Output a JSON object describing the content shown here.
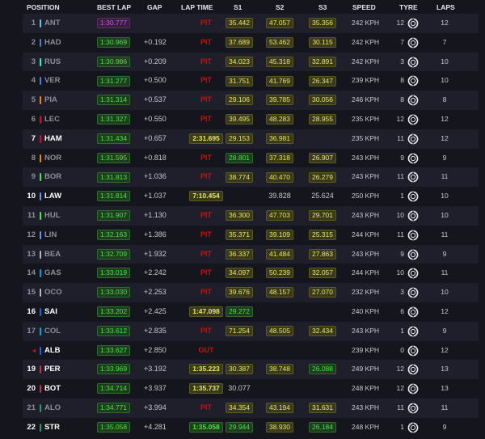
{
  "columns": [
    "POSITION",
    "BEST LAP",
    "GAP",
    "LAP TIME",
    "S1",
    "S2",
    "S3",
    "SPEED",
    "TYRE",
    "LAPS"
  ],
  "rows": [
    {
      "pos": "1",
      "code": "ANT",
      "team": "#64c4ff",
      "best": "1:30.777",
      "best_color": "purple",
      "gap": "",
      "lap": "PIT",
      "lap_type": "pit",
      "s1": "35.442",
      "s1c": "yellow",
      "s2": "47.057",
      "s2c": "yellow",
      "s3": "35.356",
      "s3c": "yellow",
      "speed": "242 KPH",
      "tyre_age": "12",
      "tyre_icon": "hard-tyre-icon",
      "laps": "12",
      "hl": false
    },
    {
      "pos": "2",
      "code": "HAD",
      "team": "#4781d7",
      "best": "1:30.969",
      "best_color": "green",
      "gap": "+0.192",
      "lap": "PIT",
      "lap_type": "pit",
      "s1": "37.689",
      "s1c": "yellow",
      "s2": "53.462",
      "s2c": "yellow",
      "s3": "30.115",
      "s3c": "yellow",
      "speed": "242 KPH",
      "tyre_age": "7",
      "tyre_icon": "medium-tyre-icon",
      "laps": "7",
      "hl": false
    },
    {
      "pos": "3",
      "code": "RUS",
      "team": "#27f4d2",
      "best": "1:30.986",
      "best_color": "green",
      "gap": "+0.209",
      "lap": "PIT",
      "lap_type": "pit",
      "s1": "34.023",
      "s1c": "yellow",
      "s2": "45.318",
      "s2c": "yellow",
      "s3": "32.891",
      "s3c": "yellow",
      "speed": "242 KPH",
      "tyre_age": "3",
      "tyre_icon": "medium-tyre-icon",
      "laps": "10",
      "hl": false
    },
    {
      "pos": "4",
      "code": "VER",
      "team": "#4781d7",
      "best": "1:31.277",
      "best_color": "green",
      "gap": "+0.500",
      "lap": "PIT",
      "lap_type": "pit",
      "s1": "31.751",
      "s1c": "yellow",
      "s2": "41.769",
      "s2c": "yellow",
      "s3": "26.347",
      "s3c": "yellow",
      "speed": "239 KPH",
      "tyre_age": "8",
      "tyre_icon": "medium-tyre-icon",
      "laps": "10",
      "hl": false
    },
    {
      "pos": "5",
      "code": "PIA",
      "team": "#ff8000",
      "best": "1:31.314",
      "best_color": "green",
      "gap": "+0.537",
      "lap": "PIT",
      "lap_type": "pit",
      "s1": "29.106",
      "s1c": "yellow",
      "s2": "39.785",
      "s2c": "yellow",
      "s3": "30.056",
      "s3c": "yellow",
      "speed": "246 KPH",
      "tyre_age": "8",
      "tyre_icon": "medium-tyre-icon",
      "laps": "8",
      "hl": false
    },
    {
      "pos": "6",
      "code": "LEC",
      "team": "#e8002d",
      "best": "1:31.327",
      "best_color": "green",
      "gap": "+0.550",
      "lap": "PIT",
      "lap_type": "pit",
      "s1": "39.495",
      "s1c": "yellow",
      "s2": "48.283",
      "s2c": "yellow",
      "s3": "28.955",
      "s3c": "yellow",
      "speed": "235 KPH",
      "tyre_age": "12",
      "tyre_icon": "hard-tyre-icon",
      "laps": "12",
      "hl": false
    },
    {
      "pos": "7",
      "code": "HAM",
      "team": "#e8002d",
      "best": "1:31.434",
      "best_color": "green",
      "gap": "+0.657",
      "lap": "2:31.695",
      "lap_type": "time",
      "s1": "29.153",
      "s1c": "yellow",
      "s2": "36.981",
      "s2c": "yellow",
      "s3": "",
      "s3c": "none",
      "speed": "235 KPH",
      "tyre_age": "11",
      "tyre_icon": "hard-tyre-icon",
      "laps": "12",
      "hl": true
    },
    {
      "pos": "8",
      "code": "NOR",
      "team": "#ff8000",
      "best": "1:31.595",
      "best_color": "green",
      "gap": "+0.818",
      "lap": "PIT",
      "lap_type": "pit",
      "s1": "28.801",
      "s1c": "green",
      "s2": "37.318",
      "s2c": "yellow",
      "s3": "26.907",
      "s3c": "yellow",
      "speed": "243 KPH",
      "tyre_age": "9",
      "tyre_icon": "medium-tyre-icon",
      "laps": "9",
      "hl": false
    },
    {
      "pos": "9",
      "code": "BOR",
      "team": "#52e252",
      "best": "1:31.813",
      "best_color": "green",
      "gap": "+1.036",
      "lap": "PIT",
      "lap_type": "pit",
      "s1": "38.774",
      "s1c": "yellow",
      "s2": "40.470",
      "s2c": "yellow",
      "s3": "26.279",
      "s3c": "yellow",
      "speed": "243 KPH",
      "tyre_age": "11",
      "tyre_icon": "medium-tyre-icon",
      "laps": "11",
      "hl": false
    },
    {
      "pos": "10",
      "code": "LAW",
      "team": "#6692ff",
      "best": "1:31.814",
      "best_color": "green",
      "gap": "+1.037",
      "lap": "7:10.454",
      "lap_type": "time",
      "s1": "",
      "s1c": "none",
      "s2": "39.828",
      "s2c": "none",
      "s3": "25.624",
      "s3c": "none",
      "speed": "250 KPH",
      "tyre_age": "1",
      "tyre_icon": "medium-tyre-icon",
      "laps": "10",
      "hl": true
    },
    {
      "pos": "11",
      "code": "HUL",
      "team": "#52e252",
      "best": "1:31.907",
      "best_color": "green",
      "gap": "+1.130",
      "lap": "PIT",
      "lap_type": "pit",
      "s1": "36.300",
      "s1c": "yellow",
      "s2": "47.703",
      "s2c": "yellow",
      "s3": "29.701",
      "s3c": "yellow",
      "speed": "243 KPH",
      "tyre_age": "10",
      "tyre_icon": "medium-tyre-icon",
      "laps": "10",
      "hl": false
    },
    {
      "pos": "12",
      "code": "LIN",
      "team": "#6692ff",
      "best": "1:32.163",
      "best_color": "green",
      "gap": "+1.386",
      "lap": "PIT",
      "lap_type": "pit",
      "s1": "35.371",
      "s1c": "yellow",
      "s2": "39.109",
      "s2c": "yellow",
      "s3": "25.315",
      "s3c": "yellow",
      "speed": "244 KPH",
      "tyre_age": "11",
      "tyre_icon": "medium-tyre-icon",
      "laps": "11",
      "hl": false
    },
    {
      "pos": "13",
      "code": "BEA",
      "team": "#b6babd",
      "best": "1:32.709",
      "best_color": "green",
      "gap": "+1.932",
      "lap": "PIT",
      "lap_type": "pit",
      "s1": "36.337",
      "s1c": "yellow",
      "s2": "41.484",
      "s2c": "yellow",
      "s3": "27.863",
      "s3c": "yellow",
      "speed": "243 KPH",
      "tyre_age": "9",
      "tyre_icon": "medium-tyre-icon",
      "laps": "9",
      "hl": false
    },
    {
      "pos": "14",
      "code": "GAS",
      "team": "#00a1e8",
      "best": "1:33.019",
      "best_color": "green",
      "gap": "+2.242",
      "lap": "PIT",
      "lap_type": "pit",
      "s1": "34.097",
      "s1c": "yellow",
      "s2": "50.239",
      "s2c": "yellow",
      "s3": "32.057",
      "s3c": "yellow",
      "speed": "244 KPH",
      "tyre_age": "10",
      "tyre_icon": "medium-tyre-icon",
      "laps": "11",
      "hl": false
    },
    {
      "pos": "15",
      "code": "OCO",
      "team": "#b6babd",
      "best": "1:33.030",
      "best_color": "green",
      "gap": "+2.253",
      "lap": "PIT",
      "lap_type": "pit",
      "s1": "39.676",
      "s1c": "yellow",
      "s2": "48.157",
      "s2c": "yellow",
      "s3": "27.070",
      "s3c": "yellow",
      "speed": "232 KPH",
      "tyre_age": "3",
      "tyre_icon": "medium-tyre-icon",
      "laps": "10",
      "hl": false
    },
    {
      "pos": "16",
      "code": "SAI",
      "team": "#1868db",
      "best": "1:33.202",
      "best_color": "green",
      "gap": "+2.425",
      "lap": "1:47.098",
      "lap_type": "time",
      "s1": "29.272",
      "s1c": "green",
      "s2": "",
      "s2c": "none",
      "s3": "",
      "s3c": "none",
      "speed": "240 KPH",
      "tyre_age": "6",
      "tyre_icon": "medium-tyre-icon",
      "laps": "12",
      "hl": true
    },
    {
      "pos": "17",
      "code": "COL",
      "team": "#00a1e8",
      "best": "1:33.612",
      "best_color": "green",
      "gap": "+2.835",
      "lap": "PIT",
      "lap_type": "pit",
      "s1": "71.254",
      "s1c": "yellow",
      "s2": "48.505",
      "s2c": "yellow",
      "s3": "32.434",
      "s3c": "yellow",
      "speed": "243 KPH",
      "tyre_age": "1",
      "tyre_icon": "medium-tyre-icon",
      "laps": "9",
      "hl": false
    },
    {
      "pos": "◂",
      "code": "ALB",
      "team": "#1868db",
      "best": "1:33.627",
      "best_color": "green",
      "gap": "+2.850",
      "lap": "OUT",
      "lap_type": "out",
      "s1": "",
      "s1c": "none",
      "s2": "",
      "s2c": "none",
      "s3": "",
      "s3c": "none",
      "speed": "239 KPH",
      "tyre_age": "0",
      "tyre_icon": "medium-tyre-icon",
      "laps": "12",
      "hl": true
    },
    {
      "pos": "19",
      "code": "PER",
      "team": "#c92d4b",
      "best": "1:33.969",
      "best_color": "green",
      "gap": "+3.192",
      "lap": "1:35.223",
      "lap_type": "time",
      "s1": "30.387",
      "s1c": "yellow",
      "s2": "38.748",
      "s2c": "yellow",
      "s3": "26.088",
      "s3c": "green",
      "speed": "249 KPH",
      "tyre_age": "12",
      "tyre_icon": "medium-tyre-icon",
      "laps": "13",
      "hl": true
    },
    {
      "pos": "20",
      "code": "BOT",
      "team": "#c92d4b",
      "best": "1:34.714",
      "best_color": "green",
      "gap": "+3.937",
      "lap": "1:35.737",
      "lap_type": "time",
      "s1": "30.077",
      "s1c": "none",
      "s2": "",
      "s2c": "none",
      "s3": "",
      "s3c": "none",
      "speed": "248 KPH",
      "tyre_age": "12",
      "tyre_icon": "medium-tyre-icon",
      "laps": "13",
      "hl": true
    },
    {
      "pos": "21",
      "code": "ALO",
      "team": "#229971",
      "best": "1:34.771",
      "best_color": "green",
      "gap": "+3.994",
      "lap": "PIT",
      "lap_type": "pit",
      "s1": "34.354",
      "s1c": "yellow",
      "s2": "43.194",
      "s2c": "yellow",
      "s3": "31.631",
      "s3c": "yellow",
      "speed": "243 KPH",
      "tyre_age": "11",
      "tyre_icon": "medium-tyre-icon",
      "laps": "11",
      "hl": false
    },
    {
      "pos": "22",
      "code": "STR",
      "team": "#229971",
      "best": "1:35.058",
      "best_color": "green",
      "gap": "+4.281",
      "lap": "1:35.058",
      "lap_type": "time-green",
      "s1": "29.944",
      "s1c": "green",
      "s2": "38.930",
      "s2c": "yellow",
      "s3": "26.184",
      "s3c": "green",
      "speed": "248 KPH",
      "tyre_age": "1",
      "tyre_icon": "medium-tyre-icon",
      "laps": "9",
      "hl": true
    }
  ],
  "colors": {
    "background": "#15151e",
    "row_alt": "#1f1f2b",
    "pit": "#e10600",
    "green": "#4be04b",
    "purple": "#c85ce6",
    "yellow": "#e6e66a"
  }
}
